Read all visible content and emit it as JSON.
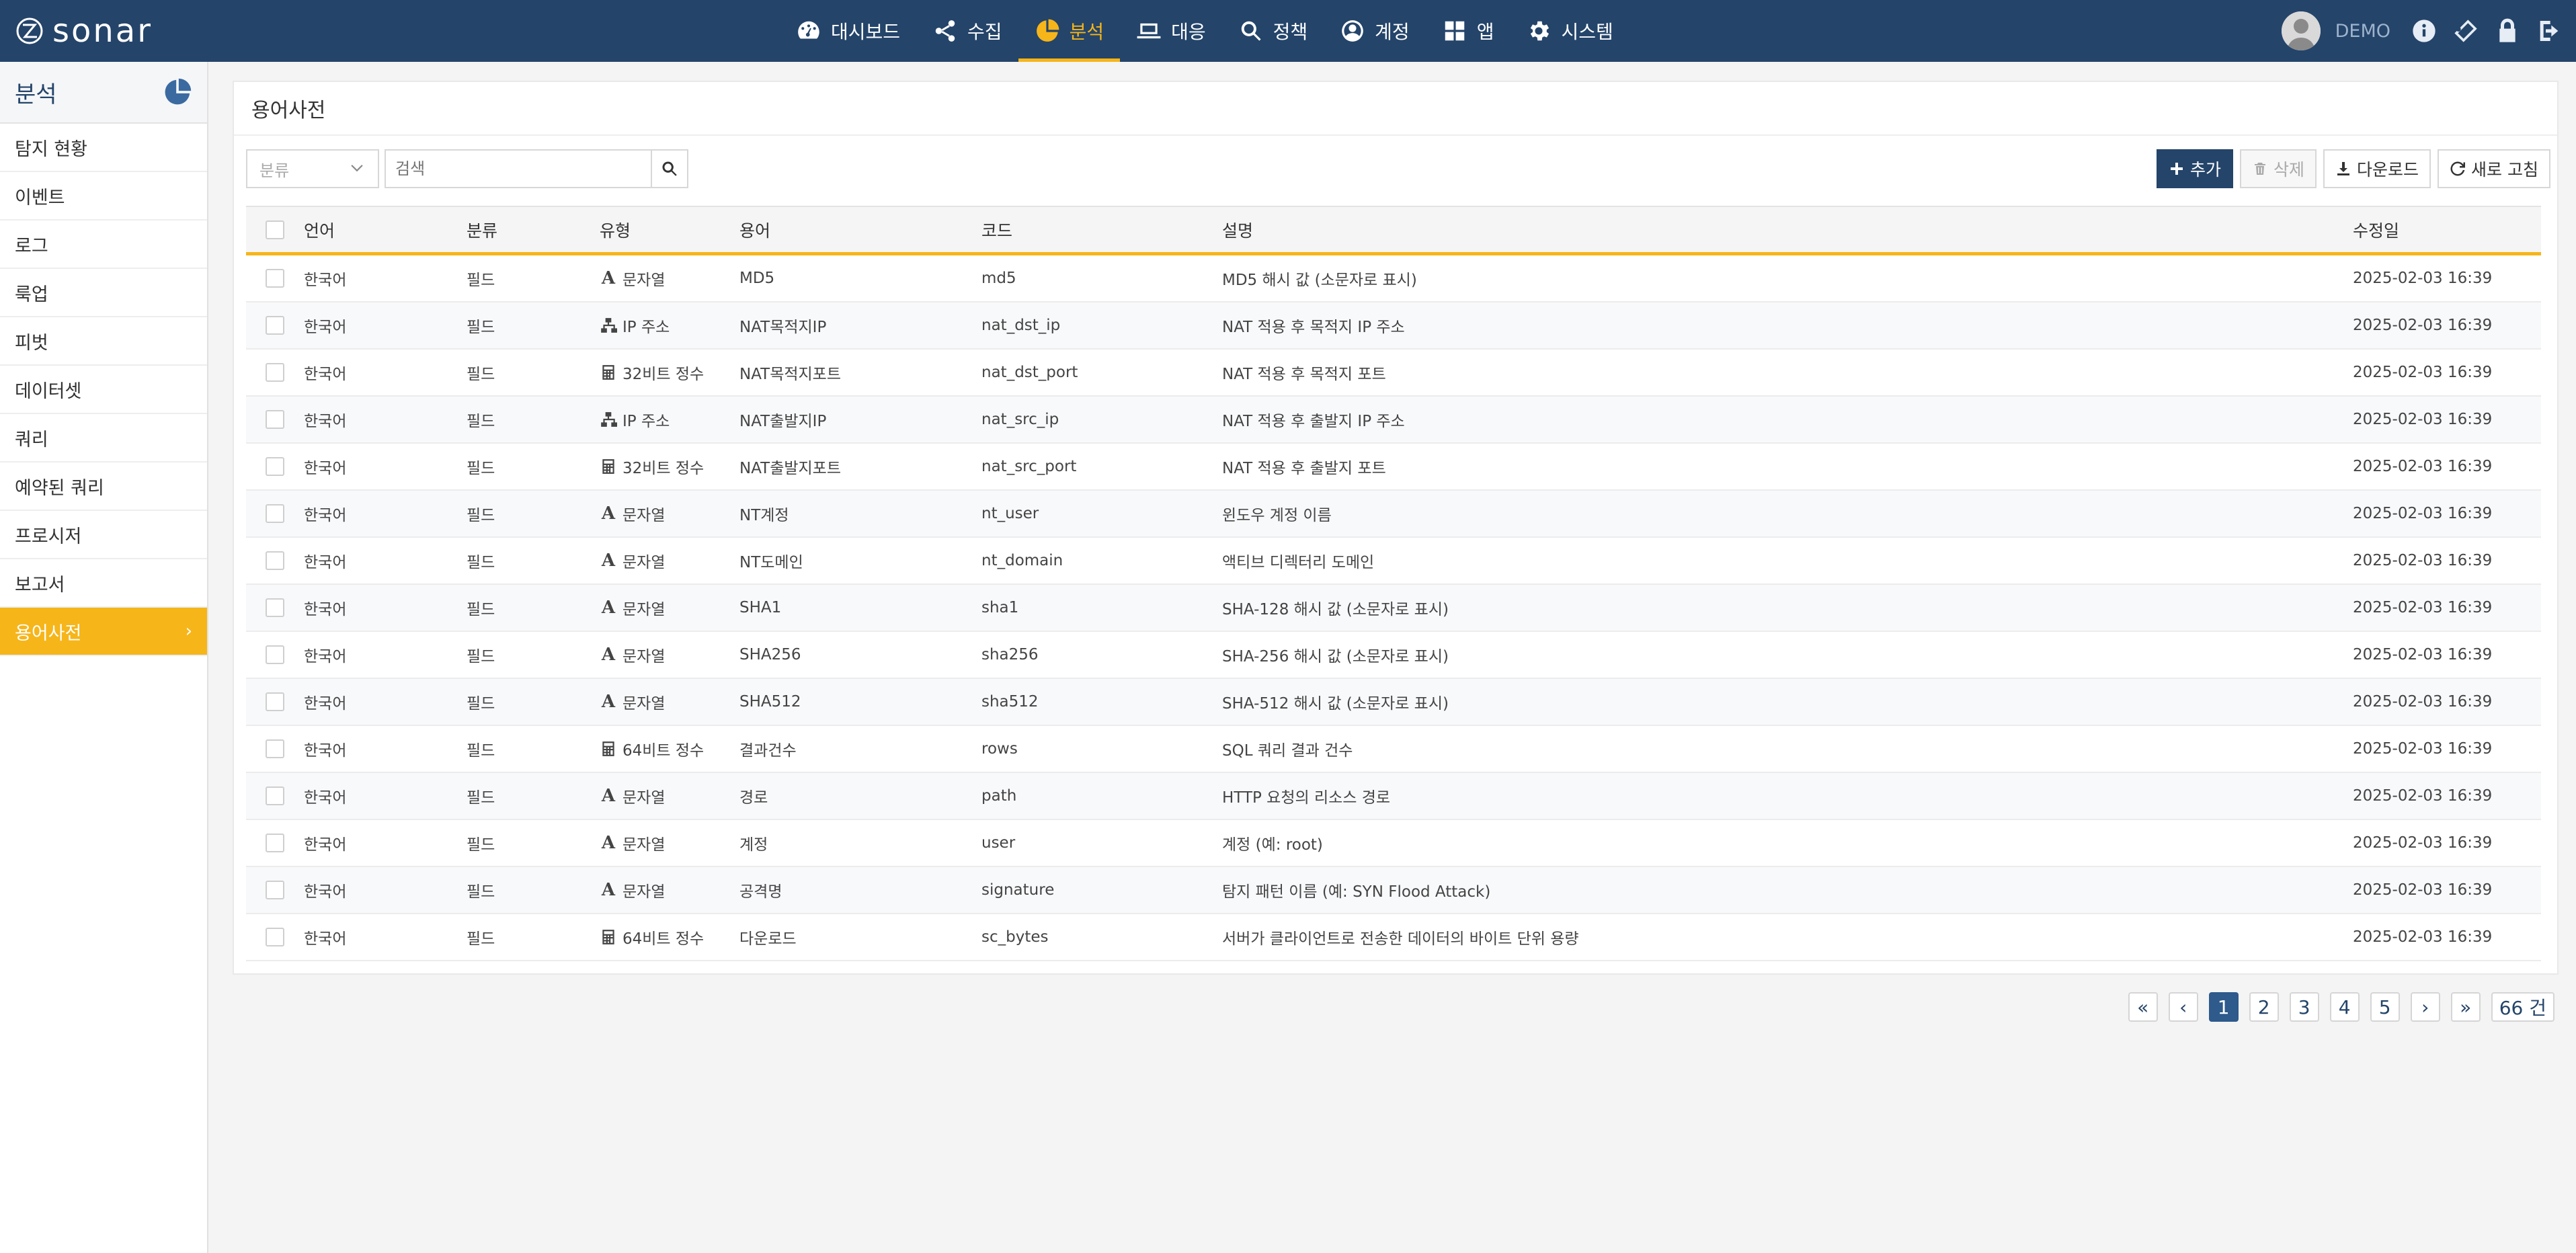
{
  "brand": {
    "name": "sonar"
  },
  "nav": {
    "items": [
      {
        "label": "대시보드",
        "icon": "dashboard-icon"
      },
      {
        "label": "수집",
        "icon": "share-icon"
      },
      {
        "label": "분석",
        "icon": "pie-chart-icon",
        "active": true
      },
      {
        "label": "대응",
        "icon": "laptop-icon"
      },
      {
        "label": "정책",
        "icon": "search-icon"
      },
      {
        "label": "계정",
        "icon": "user-circle-icon"
      },
      {
        "label": "앱",
        "icon": "grid-icon"
      },
      {
        "label": "시스템",
        "icon": "gear-icon"
      }
    ],
    "active_color": "#f6b519"
  },
  "user": {
    "name": "DEMO"
  },
  "sidebar": {
    "title": "분석",
    "items": [
      {
        "label": "탐지 현황"
      },
      {
        "label": "이벤트"
      },
      {
        "label": "로그"
      },
      {
        "label": "룩업"
      },
      {
        "label": "피벗"
      },
      {
        "label": "데이터셋"
      },
      {
        "label": "쿼리"
      },
      {
        "label": "예약된 쿼리"
      },
      {
        "label": "프로시저"
      },
      {
        "label": "보고서"
      },
      {
        "label": "용어사전",
        "active": true
      }
    ]
  },
  "page": {
    "title": "용어사전"
  },
  "toolbar": {
    "category_placeholder": "분류",
    "search_placeholder": "검색",
    "add_label": "추가",
    "delete_label": "삭제",
    "download_label": "다운로드",
    "refresh_label": "새로 고침"
  },
  "table": {
    "columns": [
      "언어",
      "분류",
      "유형",
      "용어",
      "코드",
      "설명",
      "수정일"
    ],
    "rows": [
      {
        "lang": "한국어",
        "cat": "필드",
        "type": "문자열",
        "type_icon": "letter",
        "term": "MD5",
        "code": "md5",
        "desc": "MD5 해시 값 (소문자로 표시)",
        "modified": "2025-02-03 16:39"
      },
      {
        "lang": "한국어",
        "cat": "필드",
        "type": "IP 주소",
        "type_icon": "network",
        "term": "NAT목적지IP",
        "code": "nat_dst_ip",
        "desc": "NAT 적용 후 목적지 IP 주소",
        "modified": "2025-02-03 16:39"
      },
      {
        "lang": "한국어",
        "cat": "필드",
        "type": "32비트 정수",
        "type_icon": "calc",
        "term": "NAT목적지포트",
        "code": "nat_dst_port",
        "desc": "NAT 적용 후 목적지 포트",
        "modified": "2025-02-03 16:39"
      },
      {
        "lang": "한국어",
        "cat": "필드",
        "type": "IP 주소",
        "type_icon": "network",
        "term": "NAT출발지IP",
        "code": "nat_src_ip",
        "desc": "NAT 적용 후 출발지 IP 주소",
        "modified": "2025-02-03 16:39"
      },
      {
        "lang": "한국어",
        "cat": "필드",
        "type": "32비트 정수",
        "type_icon": "calc",
        "term": "NAT출발지포트",
        "code": "nat_src_port",
        "desc": "NAT 적용 후 출발지 포트",
        "modified": "2025-02-03 16:39"
      },
      {
        "lang": "한국어",
        "cat": "필드",
        "type": "문자열",
        "type_icon": "letter",
        "term": "NT계정",
        "code": "nt_user",
        "desc": "윈도우 계정 이름",
        "modified": "2025-02-03 16:39"
      },
      {
        "lang": "한국어",
        "cat": "필드",
        "type": "문자열",
        "type_icon": "letter",
        "term": "NT도메인",
        "code": "nt_domain",
        "desc": "액티브 디렉터리 도메인",
        "modified": "2025-02-03 16:39"
      },
      {
        "lang": "한국어",
        "cat": "필드",
        "type": "문자열",
        "type_icon": "letter",
        "term": "SHA1",
        "code": "sha1",
        "desc": "SHA-128 해시 값 (소문자로 표시)",
        "modified": "2025-02-03 16:39"
      },
      {
        "lang": "한국어",
        "cat": "필드",
        "type": "문자열",
        "type_icon": "letter",
        "term": "SHA256",
        "code": "sha256",
        "desc": "SHA-256 해시 값 (소문자로 표시)",
        "modified": "2025-02-03 16:39"
      },
      {
        "lang": "한국어",
        "cat": "필드",
        "type": "문자열",
        "type_icon": "letter",
        "term": "SHA512",
        "code": "sha512",
        "desc": "SHA-512 해시 값 (소문자로 표시)",
        "modified": "2025-02-03 16:39"
      },
      {
        "lang": "한국어",
        "cat": "필드",
        "type": "64비트 정수",
        "type_icon": "calc",
        "term": "결과건수",
        "code": "rows",
        "desc": "SQL 쿼리 결과 건수",
        "modified": "2025-02-03 16:39"
      },
      {
        "lang": "한국어",
        "cat": "필드",
        "type": "문자열",
        "type_icon": "letter",
        "term": "경로",
        "code": "path",
        "desc": "HTTP 요청의 리소스 경로",
        "modified": "2025-02-03 16:39"
      },
      {
        "lang": "한국어",
        "cat": "필드",
        "type": "문자열",
        "type_icon": "letter",
        "term": "계정",
        "code": "user",
        "desc": "계정 (예: root)",
        "modified": "2025-02-03 16:39"
      },
      {
        "lang": "한국어",
        "cat": "필드",
        "type": "문자열",
        "type_icon": "letter",
        "term": "공격명",
        "code": "signature",
        "desc": "탐지 패턴 이름 (예: SYN Flood Attack)",
        "modified": "2025-02-03 16:39"
      },
      {
        "lang": "한국어",
        "cat": "필드",
        "type": "64비트 정수",
        "type_icon": "calc",
        "term": "다운로드",
        "code": "sc_bytes",
        "desc": "서버가 클라이언트로 전송한 데이터의 바이트 단위 용량",
        "modified": "2025-02-03 16:39"
      }
    ]
  },
  "pagination": {
    "first": "«",
    "prev": "‹",
    "next": "›",
    "last": "»",
    "pages": [
      "1",
      "2",
      "3",
      "4",
      "5"
    ],
    "current": "1",
    "count_label": "66 건"
  }
}
